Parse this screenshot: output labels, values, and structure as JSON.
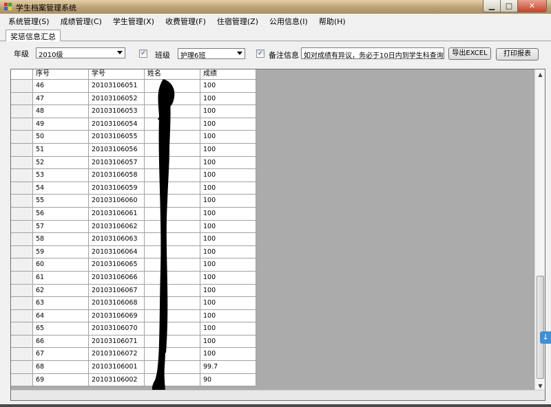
{
  "window": {
    "title": "学生档案管理系统"
  },
  "menu": [
    "系统管理(S)",
    "成绩管理(C)",
    "学生管理(X)",
    "收费管理(F)",
    "住宿管理(Z)",
    "公用信息(I)",
    "帮助(H)"
  ],
  "tab": {
    "label": "奖惩信息汇总"
  },
  "filters": {
    "grade_label": "年级",
    "grade_value": "2010级",
    "class_label": "班级",
    "class_value": "护理6班",
    "class_checked": "✓",
    "note_checked": "✓",
    "note_label": "备注信息",
    "note_value": "如对成绩有异议，务必于10日内到学生科查询"
  },
  "buttons": {
    "export": "导出EXCEL",
    "print": "打印报表"
  },
  "table": {
    "columns": [
      "序号",
      "学号",
      "姓名",
      "成绩"
    ],
    "rows": [
      [
        "46",
        "20103106051",
        "",
        "100"
      ],
      [
        "47",
        "20103106052",
        "",
        "100"
      ],
      [
        "48",
        "20103106053",
        "",
        "100"
      ],
      [
        "49",
        "20103106054",
        "",
        "100"
      ],
      [
        "50",
        "20103106055",
        "",
        "100"
      ],
      [
        "51",
        "20103106056",
        "",
        "100"
      ],
      [
        "52",
        "20103106057",
        "",
        "100"
      ],
      [
        "53",
        "20103106058",
        "",
        "100"
      ],
      [
        "54",
        "20103106059",
        "",
        "100"
      ],
      [
        "55",
        "20103106060",
        "",
        "100"
      ],
      [
        "56",
        "20103106061",
        "",
        "100"
      ],
      [
        "57",
        "20103106062",
        "",
        "100"
      ],
      [
        "58",
        "20103106063",
        "",
        "100"
      ],
      [
        "59",
        "20103106064",
        "",
        "100"
      ],
      [
        "60",
        "20103106065",
        "",
        "100"
      ],
      [
        "61",
        "20103106066",
        "",
        "100"
      ],
      [
        "62",
        "20103106067",
        "",
        "100"
      ],
      [
        "63",
        "20103106068",
        "",
        "100"
      ],
      [
        "64",
        "20103106069",
        "",
        "100"
      ],
      [
        "65",
        "20103106070",
        "",
        "100"
      ],
      [
        "66",
        "20103106071",
        "",
        "100"
      ],
      [
        "67",
        "20103106072",
        "",
        "100"
      ],
      [
        "68",
        "20103106001",
        "",
        "99.7"
      ],
      [
        "69",
        "20103106002",
        "",
        "90"
      ]
    ]
  },
  "colors": {
    "titlebar": "#b89e73",
    "grid_background": "#ababab",
    "accent": "#3d8fd6"
  }
}
